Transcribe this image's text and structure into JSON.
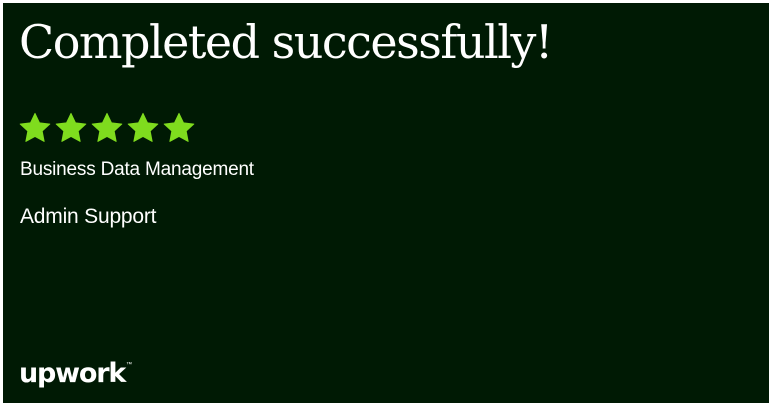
{
  "card": {
    "headline": "Completed successfully!",
    "rating": {
      "value": 5,
      "max": 5,
      "icon": "star-icon",
      "color": "#7fdc1e"
    },
    "category": "Business Data Management",
    "subcategory": "Admin Support",
    "brand": {
      "name": "upwork",
      "trademark": "™"
    },
    "colors": {
      "background": "#001a04",
      "text": "#ffffff"
    }
  }
}
